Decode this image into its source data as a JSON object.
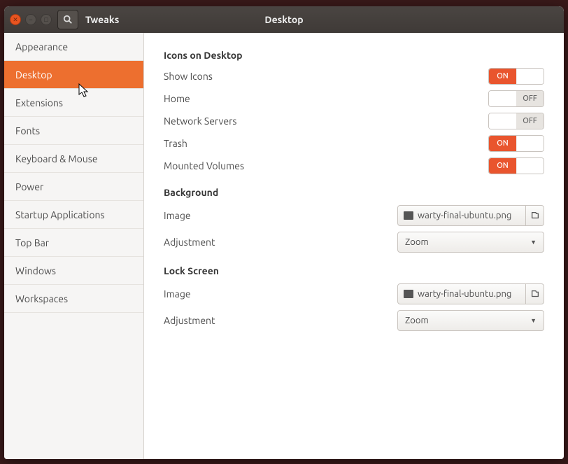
{
  "titlebar": {
    "app_title": "Tweaks",
    "page_title": "Desktop"
  },
  "sidebar": {
    "items": [
      {
        "label": "Appearance",
        "key": "appearance"
      },
      {
        "label": "Desktop",
        "key": "desktop"
      },
      {
        "label": "Extensions",
        "key": "extensions"
      },
      {
        "label": "Fonts",
        "key": "fonts"
      },
      {
        "label": "Keyboard & Mouse",
        "key": "keyboard-mouse"
      },
      {
        "label": "Power",
        "key": "power"
      },
      {
        "label": "Startup Applications",
        "key": "startup-applications"
      },
      {
        "label": "Top Bar",
        "key": "top-bar"
      },
      {
        "label": "Windows",
        "key": "windows"
      },
      {
        "label": "Workspaces",
        "key": "workspaces"
      }
    ],
    "active_key": "desktop"
  },
  "sections": {
    "icons_on_desktop": {
      "title": "Icons on Desktop",
      "rows": [
        {
          "label": "Show Icons",
          "state": "on"
        },
        {
          "label": "Home",
          "state": "off"
        },
        {
          "label": "Network Servers",
          "state": "off"
        },
        {
          "label": "Trash",
          "state": "on"
        },
        {
          "label": "Mounted Volumes",
          "state": "on"
        }
      ]
    },
    "background": {
      "title": "Background",
      "image_label": "Image",
      "image_file": "warty-final-ubuntu.png",
      "adjustment_label": "Adjustment",
      "adjustment_value": "Zoom"
    },
    "lock_screen": {
      "title": "Lock Screen",
      "image_label": "Image",
      "image_file": "warty-final-ubuntu.png",
      "adjustment_label": "Adjustment",
      "adjustment_value": "Zoom"
    }
  },
  "toggle_text": {
    "on": "ON",
    "off": "OFF"
  }
}
